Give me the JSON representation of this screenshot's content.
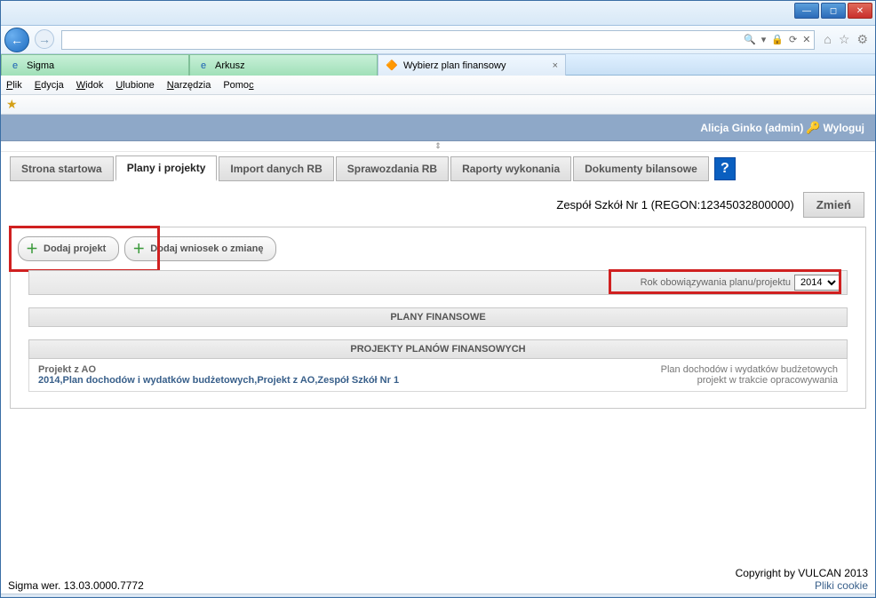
{
  "window": {
    "tabs": [
      {
        "label": "Sigma",
        "iconCls": "ie"
      },
      {
        "label": "Arkusz",
        "iconCls": "ie"
      },
      {
        "label": "Wybierz plan finansowy",
        "iconCls": "app",
        "closable": true
      }
    ]
  },
  "addressBar": {
    "value": "",
    "searchGlyph": "🔍",
    "lockGlyph": "🔒",
    "refreshGlyph": "⟳",
    "stopGlyph": "✕"
  },
  "browserIcons": {
    "home": "⌂",
    "star": "☆",
    "gear": "⚙"
  },
  "menu": {
    "items": [
      "Plik",
      "Edycja",
      "Widok",
      "Ulubione",
      "Narzędzia",
      "Pomoc"
    ]
  },
  "header": {
    "user": "Alicja Ginko (admin)",
    "logout": "Wyloguj"
  },
  "navTabs": [
    "Strona startowa",
    "Plany i projekty",
    "Import danych RB",
    "Sprawozdania RB",
    "Raporty wykonania",
    "Dokumenty bilansowe"
  ],
  "activeNav": "Plany i projekty",
  "context": {
    "school": "Zespół Szkół Nr 1 (REGON:12345032800000)",
    "changeBtn": "Zmień"
  },
  "buttons": {
    "addProject": "Dodaj projekt",
    "addRequest": "Dodaj wniosek o zmianę"
  },
  "yearRow": {
    "label": "Rok obowiązywania planu/projektu",
    "options": [
      "2014"
    ],
    "value": "2014"
  },
  "sections": {
    "plans": "PLANY FINANSOWE",
    "projects": "PROJEKTY PLANÓW FINANSOWYCH"
  },
  "projectRow": {
    "title": "Projekt z AO",
    "desc": "2014,Plan dochodów i wydatków budżetowych,Projekt z AO,Zespół Szkół Nr 1",
    "type": "Plan dochodów i wydatków budżetowych",
    "status": "projekt w trakcie opracowywania"
  },
  "footer": {
    "version": "Sigma wer. 13.03.0000.7772",
    "copyright": "Copyright by VULCAN 2013",
    "cookies": "Pliki cookie"
  }
}
